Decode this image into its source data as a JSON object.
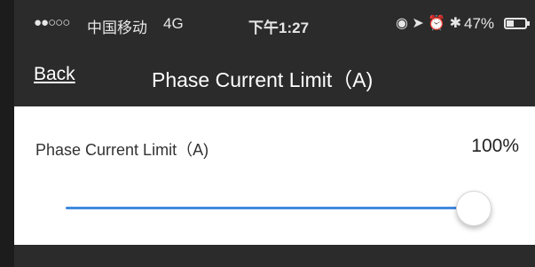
{
  "status_bar": {
    "signal": "●●○○○",
    "carrier": "中国移动",
    "network": "4G",
    "time": "下午1:27",
    "status_icons": "◉ ➤ ⏰ ✱",
    "battery": "47%",
    "battery_level": 0.47
  },
  "nav": {
    "back_label": "Back",
    "title": "Phase Current Limit（A)"
  },
  "setting": {
    "label": "Phase Current Limit（A)",
    "value_text": "100%",
    "slider_value": 1.0
  },
  "colors": {
    "accent": "#3f8ae0",
    "bar_background": "#2b2b2b",
    "card_background": "#ffffff"
  }
}
